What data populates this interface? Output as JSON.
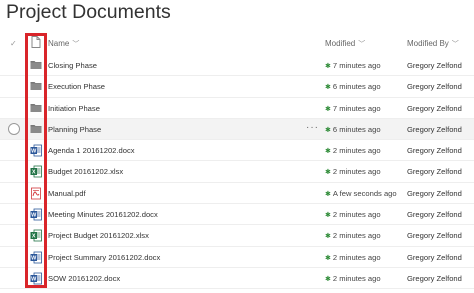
{
  "page": {
    "title": "Project Documents"
  },
  "header": {
    "name_label": "Name",
    "modified_label": "Modified",
    "modified_by_label": "Modified By"
  },
  "items": [
    {
      "type": "folder",
      "icon": "folder-icon",
      "name": "Closing Phase",
      "modified": "7 minutes ago",
      "modified_by": "Gregory Zelfond"
    },
    {
      "type": "folder",
      "icon": "folder-icon",
      "name": "Execution Phase",
      "modified": "6 minutes ago",
      "modified_by": "Gregory Zelfond"
    },
    {
      "type": "folder",
      "icon": "folder-icon",
      "name": "Initiation Phase",
      "modified": "7 minutes ago",
      "modified_by": "Gregory Zelfond"
    },
    {
      "type": "folder",
      "icon": "folder-icon",
      "name": "Planning Phase",
      "modified": "6 minutes ago",
      "modified_by": "Gregory Zelfond",
      "more_label": "···"
    },
    {
      "type": "docx",
      "icon": "word-icon",
      "name": "Agenda 1 20161202.docx",
      "modified": "2 minutes ago",
      "modified_by": "Gregory Zelfond"
    },
    {
      "type": "xlsx",
      "icon": "excel-icon",
      "name": "Budget 20161202.xlsx",
      "modified": "2 minutes ago",
      "modified_by": "Gregory Zelfond"
    },
    {
      "type": "pdf",
      "icon": "pdf-icon",
      "name": "Manual.pdf",
      "modified": "A few seconds ago",
      "modified_by": "Gregory Zelfond"
    },
    {
      "type": "docx",
      "icon": "word-icon",
      "name": "Meeting Minutes 20161202.docx",
      "modified": "2 minutes ago",
      "modified_by": "Gregory Zelfond"
    },
    {
      "type": "xlsx",
      "icon": "excel-icon",
      "name": "Project Budget 20161202.xlsx",
      "modified": "2 minutes ago",
      "modified_by": "Gregory Zelfond"
    },
    {
      "type": "docx",
      "icon": "word-icon",
      "name": "Project Summary 20161202.docx",
      "modified": "2 minutes ago",
      "modified_by": "Gregory Zelfond"
    },
    {
      "type": "docx",
      "icon": "word-icon",
      "name": "SOW 20161202.docx",
      "modified": "2 minutes ago",
      "modified_by": "Gregory Zelfond"
    }
  ],
  "colors": {
    "folder": "#777777",
    "word": "#2b579a",
    "excel": "#217346",
    "pdf": "#d13438",
    "new_dot": "#2e8b37",
    "highlight": "#d9252a"
  }
}
